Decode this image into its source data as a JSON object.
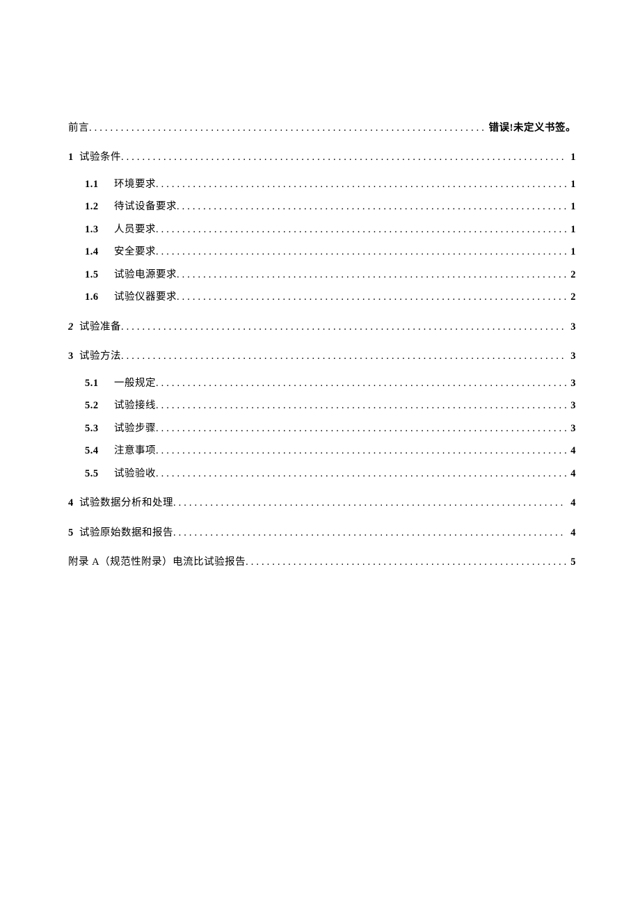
{
  "toc": {
    "lines": [
      {
        "level": "l1",
        "num": "",
        "title": "前言",
        "page": "错误!未定义书签。",
        "error": true,
        "first": true
      },
      {
        "level": "l1",
        "num": "1",
        "title": "试验条件",
        "page": "1"
      },
      {
        "block": true,
        "items": [
          {
            "level": "l2",
            "num": "1.1",
            "title": "环境要求",
            "page": "1"
          },
          {
            "level": "l2",
            "num": "1.2",
            "title": "待试设备要求",
            "page": "1"
          },
          {
            "level": "l2",
            "num": "1.3",
            "title": "人员要求",
            "page": "1"
          },
          {
            "level": "l2",
            "num": "1.4",
            "title": "安全要求",
            "page": "1"
          },
          {
            "level": "l2",
            "num": "1.5",
            "title": "试验电源要求",
            "page": "2"
          },
          {
            "level": "l2",
            "num": "1.6",
            "title": "试验仪器要求",
            "page": "2"
          }
        ]
      },
      {
        "level": "l1",
        "num": "2",
        "title": "试验准备",
        "page": "3",
        "italic": true
      },
      {
        "level": "l1",
        "num": "3",
        "title": "试验方法",
        "page": "3"
      },
      {
        "block": true,
        "items": [
          {
            "level": "l2",
            "num": "5.1",
            "title": "一般规定",
            "page": "3"
          },
          {
            "level": "l2",
            "num": "5.2",
            "title": "试验接线",
            "page": "3"
          },
          {
            "level": "l2",
            "num": "5.3",
            "title": "试验步骤",
            "page": "3"
          },
          {
            "level": "l2",
            "num": "5.4",
            "title": "注意事项",
            "page": "4"
          },
          {
            "level": "l2",
            "num": "5.5",
            "title": "试验验收",
            "page": "4"
          }
        ]
      },
      {
        "level": "l1",
        "num": "4",
        "title": "试验数据分析和处理",
        "page": "4"
      },
      {
        "level": "l1",
        "num": "5",
        "title": "试验原始数据和报告",
        "page": "4"
      },
      {
        "level": "l1",
        "num": "",
        "title": "附录 A（规范性附录）电流比试验报告",
        "page": "5"
      }
    ]
  }
}
